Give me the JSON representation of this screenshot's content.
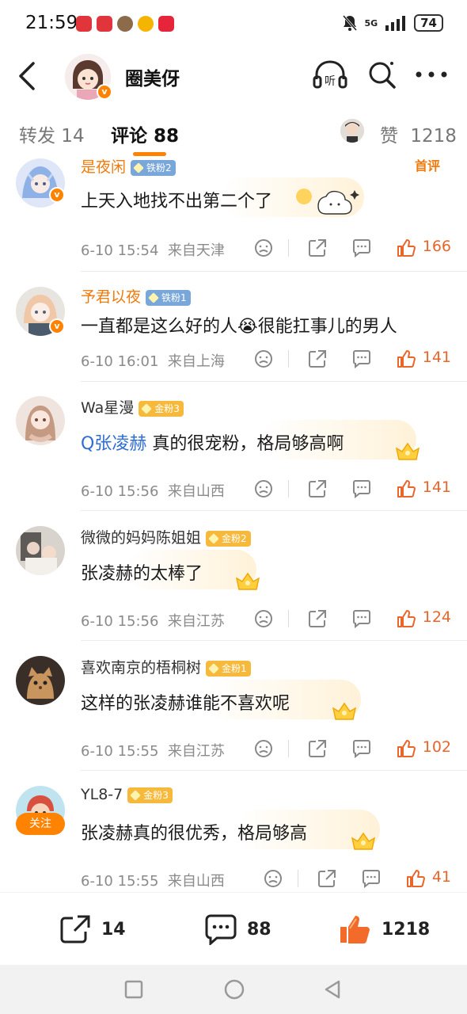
{
  "status": {
    "time": "21:59",
    "network": "5G",
    "battery": "74"
  },
  "header": {
    "title": "圈美伢"
  },
  "tabs": {
    "repost": "转发 14",
    "comments": "评论 88",
    "likes_label": "赞",
    "likes_count": "1218"
  },
  "comments": [
    {
      "name": "是夜闲",
      "badge": "铁粉2",
      "badge_type": "iron",
      "name_color": "orange",
      "text": "上天入地找不出第二个了",
      "time": "6-10 15:54",
      "location": "来自天津",
      "likes": "166",
      "top_tag": "首评"
    },
    {
      "name": "予君以夜",
      "badge": "铁粉1",
      "badge_type": "iron",
      "name_color": "orange",
      "text": "一直都是这么好的人😭很能扛事儿的男人",
      "time": "6-10 16:01",
      "location": "来自上海",
      "likes": "141"
    },
    {
      "name": "Wa星漫",
      "badge": "金粉3",
      "badge_type": "gold",
      "mention": "Q张凌赫",
      "text": " 真的很宠粉，格局够高啊",
      "time": "6-10 15:56",
      "location": "来自山西",
      "likes": "141"
    },
    {
      "name": "微微的妈妈陈姐姐",
      "badge": "金粉2",
      "badge_type": "gold",
      "text": "张凌赫的太棒了",
      "time": "6-10 15:56",
      "location": "来自江苏",
      "likes": "124"
    },
    {
      "name": "喜欢南京的梧桐树",
      "badge": "金粉1",
      "badge_type": "gold",
      "text": "这样的张凌赫谁能不喜欢呢",
      "time": "6-10 15:55",
      "location": "来自江苏",
      "likes": "102"
    },
    {
      "name": "YL8-7",
      "badge": "金粉3",
      "badge_type": "gold",
      "text": "张凌赫真的很优秀，格局够高",
      "time": "6-10 15:55",
      "location": "来自山西",
      "likes": "41",
      "follow": "关注"
    }
  ],
  "bottom": {
    "repost": "14",
    "comment": "88",
    "like": "1218"
  },
  "colors": {
    "accent": "#ff8200",
    "like": "#e8662a",
    "mention": "#2f6dd3"
  }
}
